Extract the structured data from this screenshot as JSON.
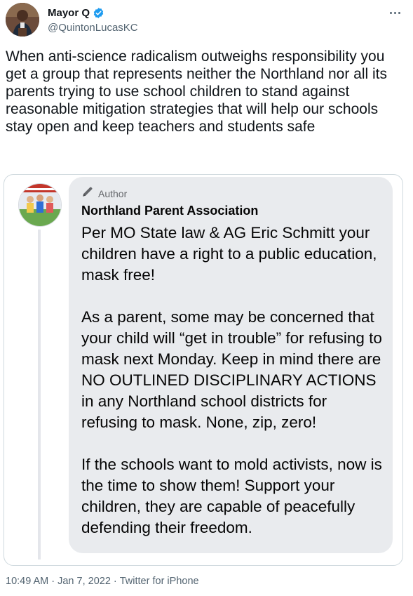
{
  "user": {
    "display_name": "Mayor Q",
    "handle": "@QuintonLucasKC"
  },
  "tweet": {
    "text": "When anti-science radicalism outweighs responsibility you get a group that represents neither the Northland nor all its parents trying to use school children to stand against reasonable mitigation strategies that will help our schools stay open and keep teachers and students safe"
  },
  "embedded_post": {
    "author_label": "Author",
    "page_name": "Northland Parent Association",
    "body": "Per MO State law & AG Eric Schmitt your children have a right to a public education, mask free!\n\nAs a parent, some may be concerned that your child will “get in trouble” for refusing to mask next Monday. Keep in mind there are NO OUTLINED DISCIPLINARY ACTIONS in any Northland school districts for refusing to mask. None, zip, zero!\n\nIf the schools want to mold activists, now is the time to show them! Support your children, they are capable of peacefully defending their freedom."
  },
  "meta": {
    "time": "10:49 AM",
    "separator": "·",
    "date": "Jan 7, 2022",
    "source": "Twitter for iPhone"
  },
  "icons": {
    "verified": "verified-badge-icon",
    "more": "more-options-icon",
    "author": "pencil-icon"
  },
  "colors": {
    "verified_blue": "#1d9bf0",
    "secondary_text": "#536471",
    "bubble_bg": "#e9ebee"
  }
}
